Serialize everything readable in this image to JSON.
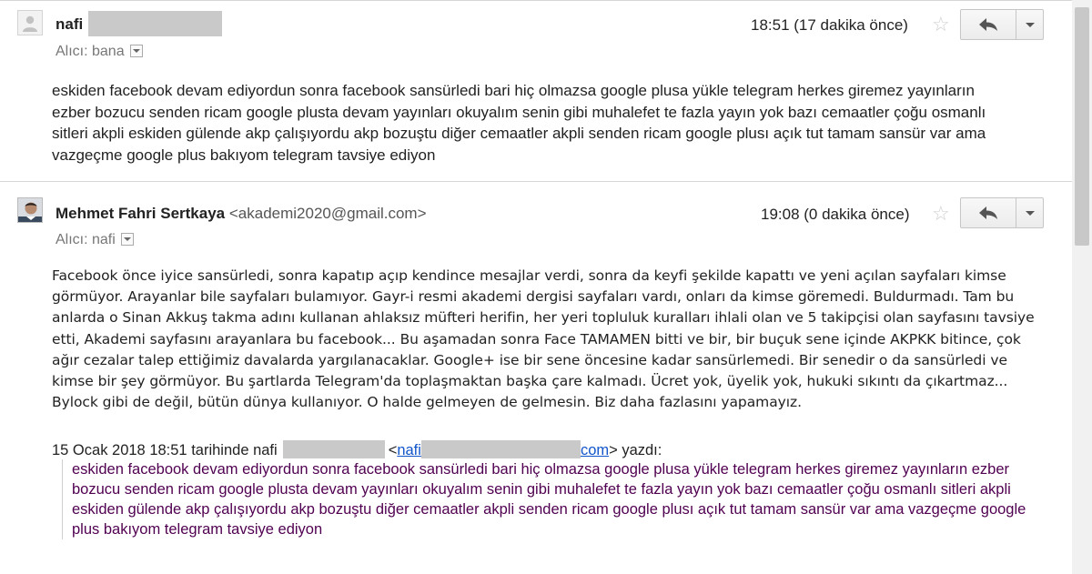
{
  "messages": [
    {
      "sender": "nafi",
      "email": "",
      "time": "18:51 (17 dakika önce)",
      "recipient": "Alıcı: bana",
      "body": "eskiden facebook devam ediyordun  sonra facebook sansürledi  bari  hiç olmazsa google plusa  yükle  telegram herkes giremez yayınların  ezber  bozucu  senden ricam google plusta devam yayınları okuyalım senin gibi muhalefet te   fazla yayın yok  bazı cemaatler   çoğu osmanlı sitleri akpli eskiden gülende akp çalışıyordu akp bozuştu  diğer cemaatler akpli  senden ricam  google plusı  açık tut  tamam sansür var ama vazgeçme google plus bakıyom telegram tavsiye ediyon"
    },
    {
      "sender": "Mehmet Fahri Sertkaya",
      "email": "<akademi2020@gmail.com>",
      "time": "19:08 (0 dakika önce)",
      "recipient": "Alıcı: nafi",
      "body": "Facebook önce iyice sansürledi, sonra kapatıp açıp kendince mesajlar verdi, sonra da keyfi şekilde kapattı ve yeni açılan sayfaları kimse görmüyor. Arayanlar bile sayfaları bulamıyor. Gayr-i resmi akademi dergisi sayfaları vardı, onları da kimse göremedi. Buldurmadı. Tam bu anlarda o Sinan Akkuş takma adını kullanan ahlaksız müfteri herifin, her yeri topluluk kuralları ihlali olan ve 5 takipçisi olan sayfasını tavsiye etti, Akademi sayfasını arayanlara bu facebook... Bu aşamadan sonra Face TAMAMEN bitti ve bir, bir buçuk sene içinde AKPKK bitince, çok ağır cezalar talep ettiğimiz davalarda yargılanacaklar. Google+ ise bir sene öncesine kadar sansürlemedi. Bir senedir o da sansürledi ve kimse bir şey görmüyor. Bu şartlarda Telegram'da toplaşmaktan başka çare kalmadı. Ücret yok, üyelik yok, hukuki sıkıntı da çıkartmaz... Bylock gibi de değil, bütün dünya kullanıyor. O halde gelmeyen de gelmesin. Biz daha fazlasını yapamayız.",
      "quote_header_prefix": "15 Ocak 2018 18:51 tarihinde nafi",
      "quote_header_lt": "<",
      "quote_link_start": "nafi",
      "quote_link_end": "com",
      "quote_header_suffix": "> yazdı:",
      "quote_body": "eskiden facebook devam ediyordun  sonra facebook sansürledi  bari  hiç olmazsa google plusa  yükle  telegram herkes giremez yayınların  ezber  bozucu  senden ricam google plusta devam yayınları okuyalım senin gibi muhalefet te   fazla yayın yok  bazı cemaatler   çoğu osmanlı sitleri akpli eskiden gülende akp çalışıyordu akp bozuştu  diğer cemaatler akpli  senden ricam  google plusı  açık tut  tamam sansür var ama vazgeçme google plus bakıyom telegram tavsiye ediyon"
    }
  ],
  "icons": {
    "star": "star-outline-icon",
    "reply": "reply-arrow-icon",
    "more": "chevron-down-icon",
    "avatar_default": "person-silhouette-icon"
  },
  "colors": {
    "quote_text": "#500050",
    "link": "#1155cc",
    "redaction": "#c9c9c9"
  }
}
